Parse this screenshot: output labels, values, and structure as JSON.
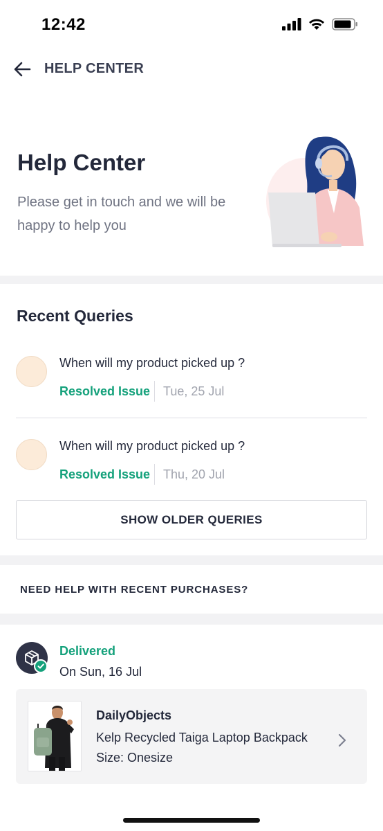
{
  "status_bar": {
    "time": "12:42"
  },
  "header": {
    "title": "HELP CENTER"
  },
  "hero": {
    "title": "Help Center",
    "subtitle": "Please get in touch and we will be happy to help you"
  },
  "recent_queries": {
    "title": "Recent Queries",
    "items": [
      {
        "question": "When will my product picked up ?",
        "status": "Resolved Issue",
        "date": "Tue, 25 Jul"
      },
      {
        "question": "When will my product picked up ?",
        "status": "Resolved Issue",
        "date": "Thu, 20 Jul"
      }
    ],
    "older_button": "SHOW OLDER QUERIES"
  },
  "purchases": {
    "title": "NEED HELP WITH RECENT PURCHASES?",
    "order": {
      "status": "Delivered",
      "date": "On Sun, 16 Jul",
      "brand": "DailyObjects",
      "product": "Kelp Recycled Taiga Laptop Backpack",
      "size": "Size: Onesize"
    }
  },
  "colors": {
    "accent_green": "#14a17b",
    "text_dark": "#23283a",
    "muted": "#a1a4ae",
    "avatar_peach": "#fcebd9"
  },
  "icons": [
    "signal-icon",
    "wifi-icon",
    "battery-icon",
    "back-arrow-icon",
    "support-agent-illustration",
    "package-icon",
    "check-icon",
    "chevron-right-icon"
  ]
}
